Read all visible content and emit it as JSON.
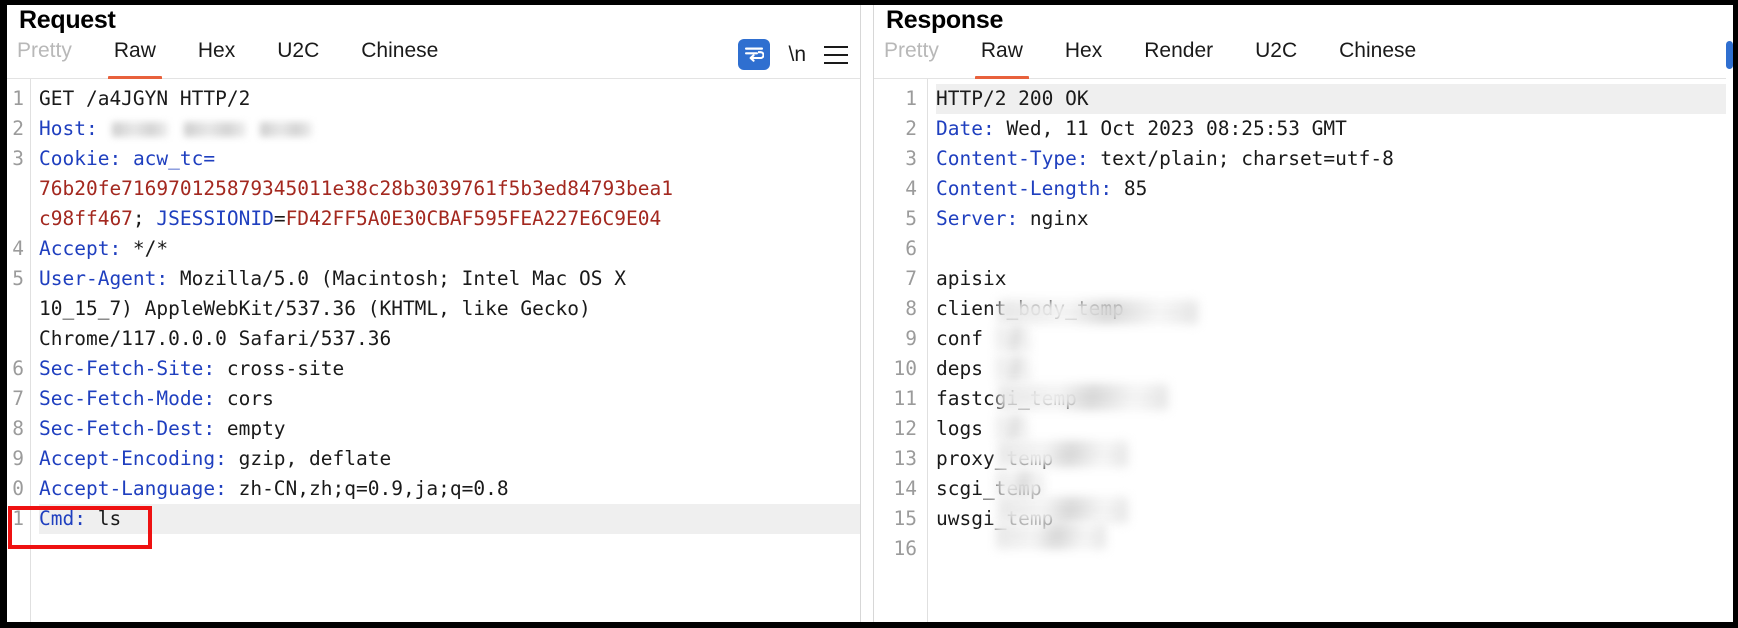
{
  "request": {
    "title": "Request",
    "tabs": [
      {
        "label": "Pretty",
        "active": false,
        "dim": true
      },
      {
        "label": "Raw",
        "active": true,
        "dim": false
      },
      {
        "label": "Hex",
        "active": false,
        "dim": false
      },
      {
        "label": "U2C",
        "active": false,
        "dim": false
      },
      {
        "label": "Chinese",
        "active": false,
        "dim": false
      }
    ],
    "actions": {
      "wrap_icon": "word-wrap-icon",
      "newline_label": "\\n",
      "menu_icon": "hamburger-menu-icon"
    },
    "line_numbers": [
      "1",
      "2",
      "3",
      "",
      "",
      "4",
      "5",
      "",
      "",
      "6",
      "7",
      "8",
      "9",
      "0",
      "1"
    ],
    "lines": {
      "l1_method": "GET /a4JGYN HTTP/2",
      "l2_key": "Host:",
      "l3_key": "Cookie:",
      "l3_name": "acw_tc",
      "l3_eq": "=",
      "l3_val_a": "76b20fe716970125879345011e38c28b3039761f5b3ed84793bea1",
      "l3_val_b": "c98ff467",
      "l3_semi": "; ",
      "l3_name2": "JSESSIONID",
      "l3_eq2": "=",
      "l3_val_c": "FD42FF5A0E30CBAF595FEA227E6C9E04",
      "l4_key": "Accept:",
      "l4_val": " */*",
      "l5_key": "User-Agent:",
      "l5_val": " Mozilla/5.0 (Macintosh; Intel Mac OS X",
      "l5_cont1": "10_15_7) AppleWebKit/537.36 (KHTML, like Gecko)",
      "l5_cont2": "Chrome/117.0.0.0 Safari/537.36",
      "l6_key": "Sec-Fetch-Site:",
      "l6_val": " cross-site",
      "l7_key": "Sec-Fetch-Mode:",
      "l7_val": " cors",
      "l8_key": "Sec-Fetch-Dest:",
      "l8_val": " empty",
      "l9_key": "Accept-Encoding:",
      "l9_val": " gzip, deflate",
      "l10_key": "Accept-Language:",
      "l10_val": " zh-CN,zh;q=0.9,ja;q=0.8",
      "l11_key": "Cmd:",
      "l11_val": " ls"
    },
    "highlight": {
      "target": "Cmd: ls",
      "color": "#ee1111"
    }
  },
  "response": {
    "title": "Response",
    "tabs": [
      {
        "label": "Pretty",
        "active": false,
        "dim": true
      },
      {
        "label": "Raw",
        "active": true,
        "dim": false
      },
      {
        "label": "Hex",
        "active": false,
        "dim": false
      },
      {
        "label": "Render",
        "active": false,
        "dim": false
      },
      {
        "label": "U2C",
        "active": false,
        "dim": false
      },
      {
        "label": "Chinese",
        "active": false,
        "dim": false
      }
    ],
    "line_numbers": [
      "1",
      "2",
      "3",
      "4",
      "5",
      "6",
      "7",
      "8",
      "9",
      "10",
      "11",
      "12",
      "13",
      "14",
      "15",
      "16"
    ],
    "lines": {
      "l1_status": "HTTP/2 200 OK",
      "l2_key": "Date:",
      "l2_val": " Wed, 11 Oct 2023 08:25:53 GMT",
      "l3_key": "Content-Type:",
      "l3_val": " text/plain; charset=utf-8",
      "l4_key": "Content-Length:",
      "l4_val": " 85",
      "l5_key": "Server:",
      "l5_val": " nginx",
      "l6_blank": "",
      "l7_body": "apisix",
      "l8_body": "client_body_temp",
      "l9_body": "conf",
      "l10_body": "deps",
      "l11_body": "fastcgi_temp",
      "l12_body": "logs",
      "l13_body": "proxy_temp",
      "l14_body": "scgi_temp",
      "l15_body": "uwsgi_temp",
      "l16_body": ""
    }
  },
  "colors": {
    "accent": "#e8613c",
    "header_key": "#1f3fbf",
    "value_red": "#a3281f",
    "highlight_box": "#ee1111",
    "wrap_button": "#2f6fd0"
  }
}
